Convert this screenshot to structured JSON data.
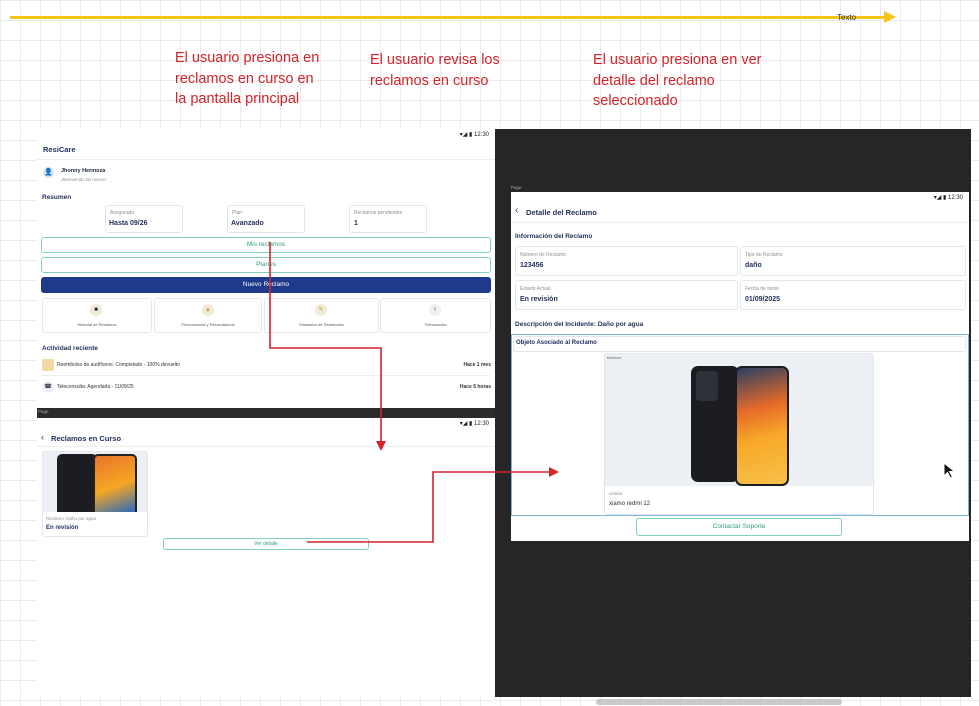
{
  "timeline": {
    "label": "Texto"
  },
  "notes": [
    "El usuario presiona en reclamos en curso en la pantalla principal",
    "El usuario revisa los reclamos en curso",
    "El usuario presiona en ver detalle del reclamo seleccionado"
  ],
  "colors": {
    "arrow": "#d4232a",
    "timeline": "#f5c518",
    "brand": "#1f3a8a",
    "accent": "#2f9f7e",
    "dark_canvas": "#262626"
  },
  "page_tag": "Page",
  "status_time": "12:30",
  "home": {
    "app_title": "ResiCare",
    "user_name": "Jhonny Hermoza",
    "user_greeting": "¡Bienvenido de nuevo!",
    "summary_title": "Resumen",
    "stats": [
      {
        "label": "Asegurado",
        "value": "Hasta 09/26"
      },
      {
        "label": "Plan",
        "value": "Avanzado"
      },
      {
        "label": "Reclamos pendientes",
        "value": "1"
      }
    ],
    "btn_my_claims": "Mis reclamos",
    "btn_plans": "Planes",
    "btn_new_claim": "Nuevo Reclamo",
    "quick_actions": [
      "Historial de Reclamos",
      "Prevenciones y Recordatorios",
      "Simulador de Reembolso",
      "Teleconsulta"
    ],
    "activity_title": "Actividad reciente",
    "activities": [
      {
        "text": "Reembolso de audífonos: Completado - 100% devuelto",
        "time": "Hace 1 mes"
      },
      {
        "text": "Teleconsulta: Agendada - 11/09/25",
        "time": "Hace 5 horas"
      }
    ]
  },
  "list": {
    "title": "Reclamos en Curso",
    "claim_label": "Reclamo: Daño por agua",
    "claim_status": "En revisión",
    "detail_button": "Ver detalle"
  },
  "detail": {
    "title": "Detalle del Reclamo",
    "section_info": "Información del Reclamo",
    "fields": [
      {
        "label": "Número de Reclamo",
        "value": "123456"
      },
      {
        "label": "Tipo de Reclamo",
        "value": "daño"
      },
      {
        "label": "Estado Actual",
        "value": "En revisión"
      },
      {
        "label": "Fecha de Inicio",
        "value": "01/09/2025"
      }
    ],
    "incident": "Descripción del Incidente: Daño por agua",
    "object_section": "Objeto Asociado al Reclamo",
    "object_tag": "teléfono",
    "object_category": "celular",
    "object_name": "xiamo redmi 12",
    "contact_button": "Contactar Soporte"
  }
}
